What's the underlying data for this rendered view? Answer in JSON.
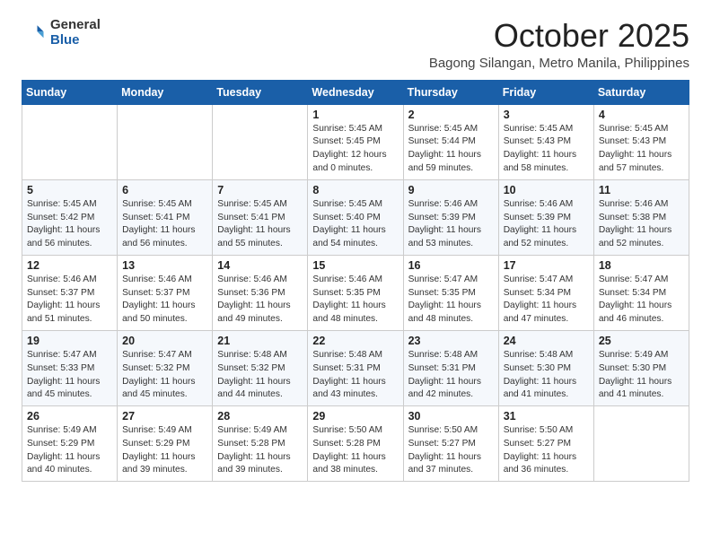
{
  "logo": {
    "general": "General",
    "blue": "Blue"
  },
  "title": {
    "month": "October 2025",
    "location": "Bagong Silangan, Metro Manila, Philippines"
  },
  "headers": [
    "Sunday",
    "Monday",
    "Tuesday",
    "Wednesday",
    "Thursday",
    "Friday",
    "Saturday"
  ],
  "weeks": [
    [
      {
        "day": "",
        "info": ""
      },
      {
        "day": "",
        "info": ""
      },
      {
        "day": "",
        "info": ""
      },
      {
        "day": "1",
        "info": "Sunrise: 5:45 AM\nSunset: 5:45 PM\nDaylight: 12 hours\nand 0 minutes."
      },
      {
        "day": "2",
        "info": "Sunrise: 5:45 AM\nSunset: 5:44 PM\nDaylight: 11 hours\nand 59 minutes."
      },
      {
        "day": "3",
        "info": "Sunrise: 5:45 AM\nSunset: 5:43 PM\nDaylight: 11 hours\nand 58 minutes."
      },
      {
        "day": "4",
        "info": "Sunrise: 5:45 AM\nSunset: 5:43 PM\nDaylight: 11 hours\nand 57 minutes."
      }
    ],
    [
      {
        "day": "5",
        "info": "Sunrise: 5:45 AM\nSunset: 5:42 PM\nDaylight: 11 hours\nand 56 minutes."
      },
      {
        "day": "6",
        "info": "Sunrise: 5:45 AM\nSunset: 5:41 PM\nDaylight: 11 hours\nand 56 minutes."
      },
      {
        "day": "7",
        "info": "Sunrise: 5:45 AM\nSunset: 5:41 PM\nDaylight: 11 hours\nand 55 minutes."
      },
      {
        "day": "8",
        "info": "Sunrise: 5:45 AM\nSunset: 5:40 PM\nDaylight: 11 hours\nand 54 minutes."
      },
      {
        "day": "9",
        "info": "Sunrise: 5:46 AM\nSunset: 5:39 PM\nDaylight: 11 hours\nand 53 minutes."
      },
      {
        "day": "10",
        "info": "Sunrise: 5:46 AM\nSunset: 5:39 PM\nDaylight: 11 hours\nand 52 minutes."
      },
      {
        "day": "11",
        "info": "Sunrise: 5:46 AM\nSunset: 5:38 PM\nDaylight: 11 hours\nand 52 minutes."
      }
    ],
    [
      {
        "day": "12",
        "info": "Sunrise: 5:46 AM\nSunset: 5:37 PM\nDaylight: 11 hours\nand 51 minutes."
      },
      {
        "day": "13",
        "info": "Sunrise: 5:46 AM\nSunset: 5:37 PM\nDaylight: 11 hours\nand 50 minutes."
      },
      {
        "day": "14",
        "info": "Sunrise: 5:46 AM\nSunset: 5:36 PM\nDaylight: 11 hours\nand 49 minutes."
      },
      {
        "day": "15",
        "info": "Sunrise: 5:46 AM\nSunset: 5:35 PM\nDaylight: 11 hours\nand 48 minutes."
      },
      {
        "day": "16",
        "info": "Sunrise: 5:47 AM\nSunset: 5:35 PM\nDaylight: 11 hours\nand 48 minutes."
      },
      {
        "day": "17",
        "info": "Sunrise: 5:47 AM\nSunset: 5:34 PM\nDaylight: 11 hours\nand 47 minutes."
      },
      {
        "day": "18",
        "info": "Sunrise: 5:47 AM\nSunset: 5:34 PM\nDaylight: 11 hours\nand 46 minutes."
      }
    ],
    [
      {
        "day": "19",
        "info": "Sunrise: 5:47 AM\nSunset: 5:33 PM\nDaylight: 11 hours\nand 45 minutes."
      },
      {
        "day": "20",
        "info": "Sunrise: 5:47 AM\nSunset: 5:32 PM\nDaylight: 11 hours\nand 45 minutes."
      },
      {
        "day": "21",
        "info": "Sunrise: 5:48 AM\nSunset: 5:32 PM\nDaylight: 11 hours\nand 44 minutes."
      },
      {
        "day": "22",
        "info": "Sunrise: 5:48 AM\nSunset: 5:31 PM\nDaylight: 11 hours\nand 43 minutes."
      },
      {
        "day": "23",
        "info": "Sunrise: 5:48 AM\nSunset: 5:31 PM\nDaylight: 11 hours\nand 42 minutes."
      },
      {
        "day": "24",
        "info": "Sunrise: 5:48 AM\nSunset: 5:30 PM\nDaylight: 11 hours\nand 41 minutes."
      },
      {
        "day": "25",
        "info": "Sunrise: 5:49 AM\nSunset: 5:30 PM\nDaylight: 11 hours\nand 41 minutes."
      }
    ],
    [
      {
        "day": "26",
        "info": "Sunrise: 5:49 AM\nSunset: 5:29 PM\nDaylight: 11 hours\nand 40 minutes."
      },
      {
        "day": "27",
        "info": "Sunrise: 5:49 AM\nSunset: 5:29 PM\nDaylight: 11 hours\nand 39 minutes."
      },
      {
        "day": "28",
        "info": "Sunrise: 5:49 AM\nSunset: 5:28 PM\nDaylight: 11 hours\nand 39 minutes."
      },
      {
        "day": "29",
        "info": "Sunrise: 5:50 AM\nSunset: 5:28 PM\nDaylight: 11 hours\nand 38 minutes."
      },
      {
        "day": "30",
        "info": "Sunrise: 5:50 AM\nSunset: 5:27 PM\nDaylight: 11 hours\nand 37 minutes."
      },
      {
        "day": "31",
        "info": "Sunrise: 5:50 AM\nSunset: 5:27 PM\nDaylight: 11 hours\nand 36 minutes."
      },
      {
        "day": "",
        "info": ""
      }
    ]
  ]
}
